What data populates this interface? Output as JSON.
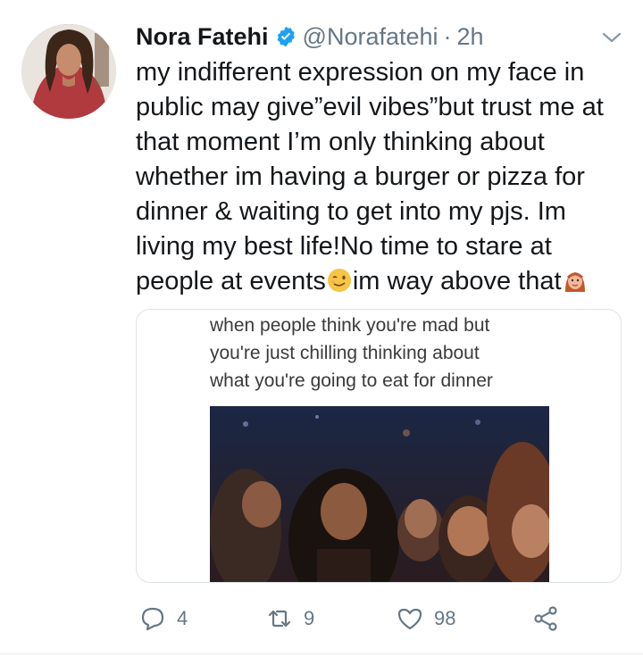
{
  "tweet": {
    "author": {
      "name": "Nora Fatehi",
      "handle": "@Norafatehi",
      "time": "2h",
      "verified": true
    },
    "text_lines": [
      "my indifferent expression on my face in",
      "public may give”evil vibes”but trust me at",
      "that moment I’m only thinking about",
      "whether im having a burger or pizza for",
      "dinner & waiting to get into my pjs. Im",
      "living my best life!No time to stare at"
    ],
    "last_line": {
      "part1": "people at events",
      "part2": "im way above that",
      "emoji1": "winking-face-icon",
      "emoji2": "woman-tipping-hand-icon"
    },
    "media": {
      "caption": "when people think you're mad but\nyou're just chilling thinking about\nwhat you're going to eat for dinner"
    },
    "actions": {
      "replies": "4",
      "retweets": "9",
      "likes": "98"
    }
  },
  "colors": {
    "verified_blue": "#1da1f2",
    "secondary_text": "#657786",
    "primary_text": "#14171a",
    "card_border": "#dfe4e8"
  }
}
